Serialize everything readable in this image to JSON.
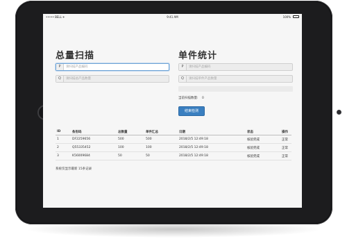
{
  "statusbar": {
    "carrier": "••••• BELL ✈",
    "time": "9:41 AM",
    "battery": "100%"
  },
  "scan_panel": {
    "title": "总量扫描",
    "product_field": {
      "addon": "P",
      "placeholder": "请扫描产品编码",
      "value": ""
    },
    "qty_field": {
      "addon": "Q",
      "placeholder": "请扫描总产品数量",
      "value": ""
    }
  },
  "unit_panel": {
    "title": "单件统计",
    "product_field": {
      "addon": "P",
      "placeholder": "请扫描产品编码",
      "value": ""
    },
    "qty_field": {
      "addon": "Q",
      "placeholder": "请扫描单件产品数量",
      "value": ""
    },
    "scanned_label": "当前扫描数量:",
    "scanned_value": "0",
    "finish_button": "结束检测"
  },
  "table": {
    "headers": [
      "ID",
      "条形码",
      "总数量",
      "单件汇总",
      "日期",
      "状态",
      "操作"
    ],
    "rows": [
      [
        "1",
        "DF2259656",
        "500",
        "500",
        "2018/2/5 12:49:18",
        "核验完成",
        "正常"
      ],
      [
        "2",
        "Q55335452",
        "100",
        "100",
        "2018/2/5 12:49:18",
        "核验完成",
        "正常"
      ],
      [
        "3",
        "K56009684",
        "50",
        "50",
        "2018/2/5 12:49:18",
        "核验完成",
        "正常"
      ]
    ]
  },
  "footer_text": "系统仅显示最新 15条记录"
}
